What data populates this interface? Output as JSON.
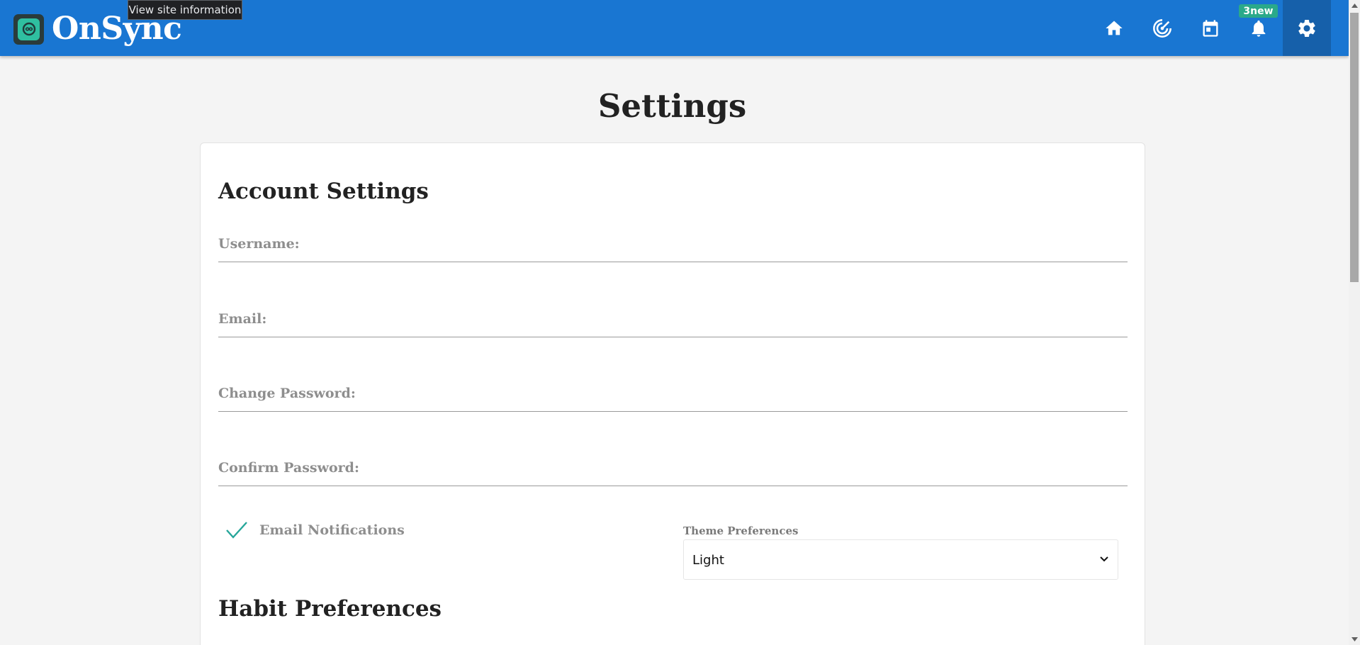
{
  "browser": {
    "tooltip": "View site information"
  },
  "navbar": {
    "brand": "OnSync",
    "brand_icon": "infinity-logo-icon",
    "icons": [
      "home-icon",
      "radar-icon",
      "calendar-icon",
      "bell-icon",
      "gear-icon"
    ],
    "notification_badge": "3new",
    "active_item": "settings",
    "color": "#1976d2"
  },
  "page": {
    "title": "Settings"
  },
  "account": {
    "heading": "Account Settings",
    "username_label": "Username:",
    "email_label": "Email:",
    "change_password_label": "Change Password:",
    "confirm_password_label": "Confirm Password:",
    "email_notifications_label": "Email Notifications",
    "email_notifications_checked": true
  },
  "theme": {
    "label": "Theme Preferences",
    "selected": "Light"
  },
  "habit": {
    "heading": "Habit Preferences"
  },
  "colors": {
    "accent": "#1976d2",
    "badge": "#2aa98a",
    "check": "#26a69a"
  }
}
